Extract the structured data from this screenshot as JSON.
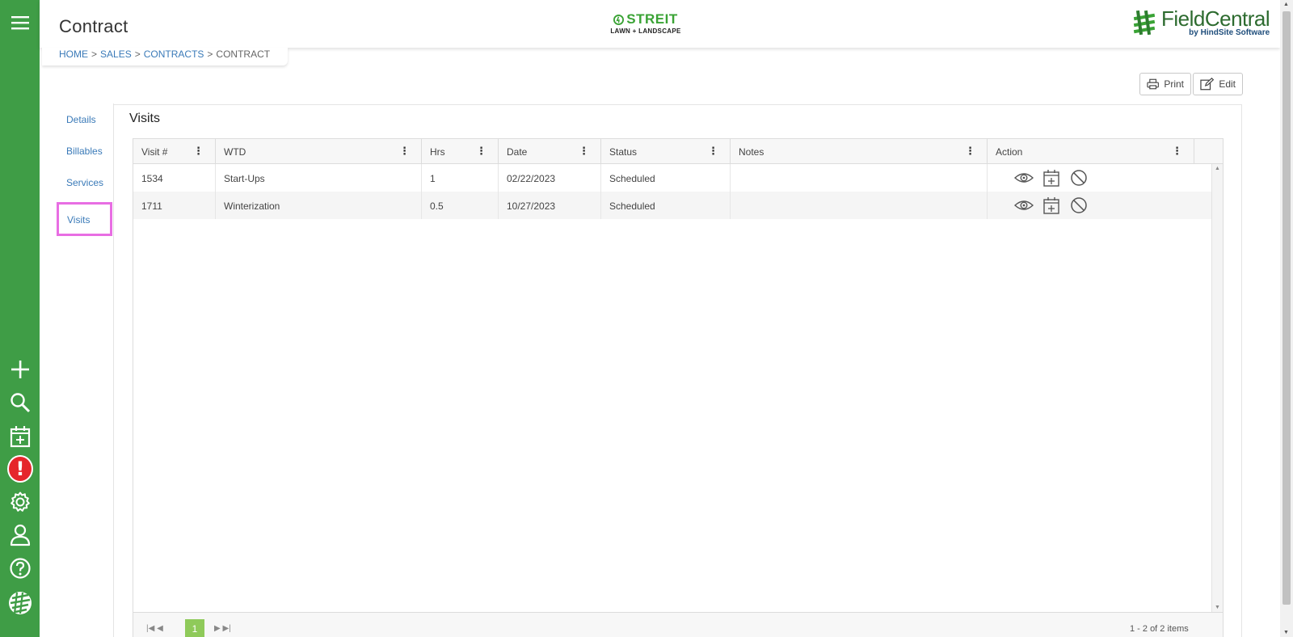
{
  "header": {
    "title": "Contract",
    "company_name": "STREIT",
    "company_sub": "LAWN + LANDSCAPE",
    "app_name": "FieldCentral",
    "app_sub": "by HindSite Software"
  },
  "breadcrumb": {
    "items": [
      "HOME",
      "SALES",
      "CONTRACTS"
    ],
    "current": "CONTRACT",
    "separator": ">"
  },
  "toolbar": {
    "print_label": "Print",
    "edit_label": "Edit"
  },
  "tabs": [
    "Details",
    "Billables",
    "Services",
    "Visits"
  ],
  "panel": {
    "title": "Visits"
  },
  "grid": {
    "columns": [
      "Visit #",
      "WTD",
      "Hrs",
      "Date",
      "Status",
      "Notes",
      "Action"
    ],
    "rows": [
      {
        "visit": "1534",
        "wtd": "Start-Ups",
        "hrs": "1",
        "date": "02/22/2023",
        "status": "Scheduled",
        "notes": ""
      },
      {
        "visit": "1711",
        "wtd": "Winterization",
        "hrs": "0.5",
        "date": "10/27/2023",
        "status": "Scheduled",
        "notes": ""
      }
    ],
    "action_icons": [
      "view-icon",
      "schedule-icon",
      "cancel-icon"
    ]
  },
  "pager": {
    "current_page": "1",
    "info": "1 - 2 of 2 items"
  },
  "colors": {
    "rail": "#3f9d46",
    "link": "#3a7ab8",
    "highlight": "#e86ee3",
    "alert": "#e5262b",
    "pager_active": "#8fca5a"
  },
  "rail_icons": [
    "menu-icon",
    "add-icon",
    "search-icon",
    "calendar-add-icon",
    "alert-icon",
    "settings-icon",
    "user-icon",
    "help-icon",
    "logo-icon"
  ]
}
